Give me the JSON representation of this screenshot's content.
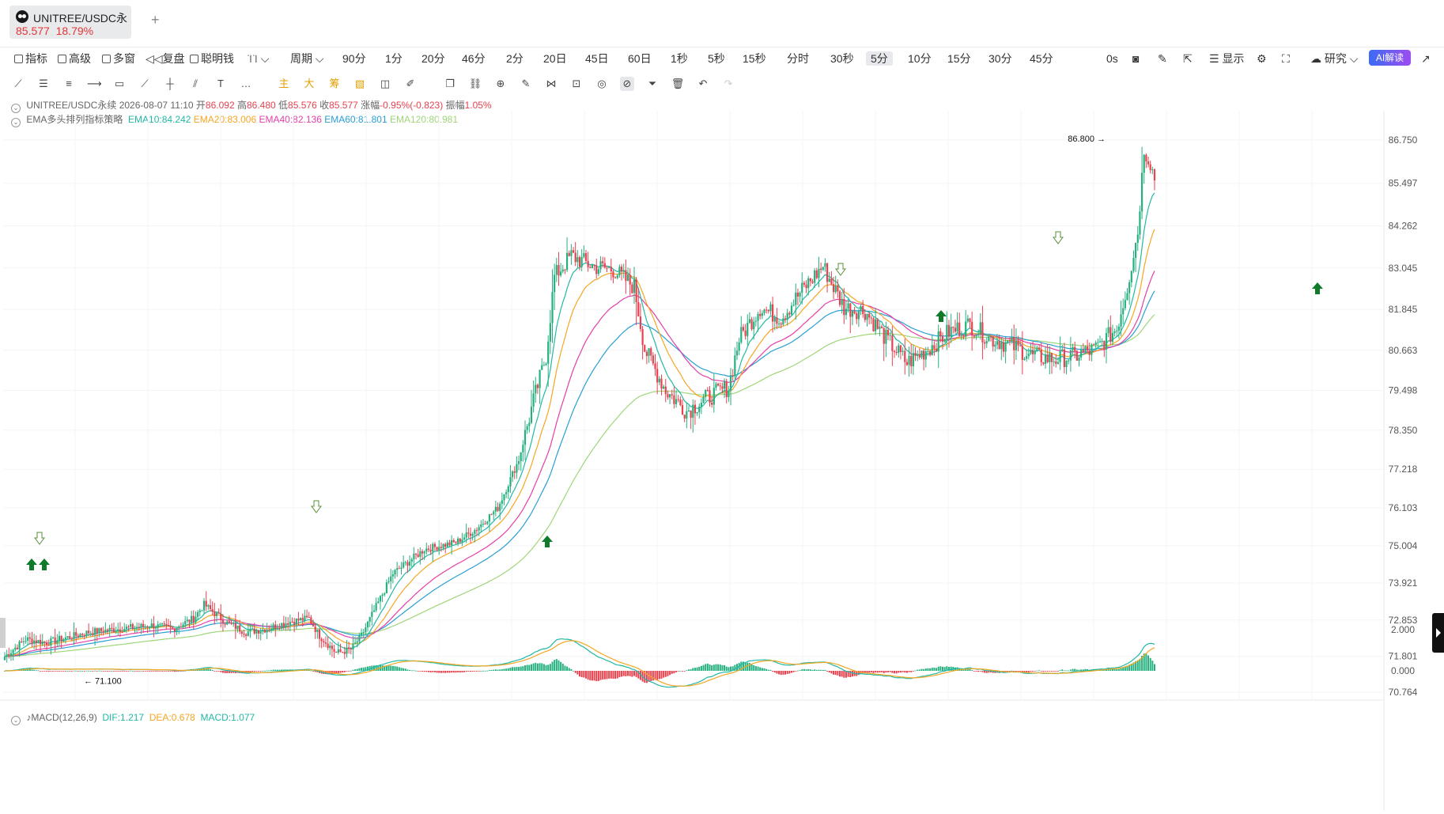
{
  "tab": {
    "title": "UNITREE/USDC永",
    "price": "85.577",
    "change": "18.79%",
    "add_label": "+"
  },
  "toolbar": {
    "indicators": "指标",
    "advanced": "高级",
    "multi_window": "多窗",
    "replay": "复盘",
    "smart_money": "聪明钱",
    "period": "周期",
    "periods": [
      "90分",
      "1分",
      "20分",
      "46分",
      "2分",
      "20日",
      "45日",
      "60日",
      "1秒",
      "5秒",
      "15秒",
      "分时",
      "30秒",
      "5分",
      "10分",
      "15分",
      "30分",
      "45分"
    ],
    "active_period": "5分",
    "seconds": "0s",
    "display": "显示",
    "research": "研究",
    "ai": "AI解读"
  },
  "legend": {
    "symbol": "UNITREE/USDC永续",
    "datetime": "2026-08-07 11:10",
    "open_label": "开",
    "open": "86.092",
    "high_label": "高",
    "high": "86.480",
    "low_label": "低",
    "low": "85.576",
    "close_label": "收",
    "close": "85.577",
    "change_label": "涨幅",
    "change": "-0.95%(-0.823)",
    "amplitude_label": "振幅",
    "amplitude": "1.05%",
    "strategy": "EMA多头排列指标策略",
    "ema10": "EMA10:84.242",
    "ema20": "EMA20:83.006",
    "ema40": "EMA40:82.136",
    "ema60": "EMA60:81.801",
    "ema120": "EMA120:80.981",
    "macd": "MACD(12,26,9)",
    "dif": "DIF:1.217",
    "dea": "DEA:0.678",
    "macd_val": "MACD:1.077"
  },
  "colors": {
    "up": "#26b07f",
    "down": "#e8424f",
    "ema10": "#22b8a5",
    "ema20": "#f5a623",
    "ema40": "#e43fa6",
    "ema60": "#2a9fd6",
    "ema120": "#9fd67a",
    "signal": "#0f7a2a"
  },
  "chart_data": {
    "type": "candlestick",
    "y_ticks": [
      "86.750",
      "85.497",
      "84.262",
      "83.045",
      "81.845",
      "80.663",
      "79.498",
      "78.350",
      "77.218",
      "76.103",
      "75.004",
      "73.921",
      "72.853",
      "71.801",
      "70.764"
    ],
    "y_range": [
      70.764,
      86.75
    ],
    "high_marker": "86.800",
    "low_marker": "71.100",
    "macd_ticks": [
      "2.000",
      "0.000"
    ],
    "close_profile": [
      [
        0,
        71.8
      ],
      [
        10,
        72.3
      ],
      [
        20,
        72.2
      ],
      [
        40,
        72.5
      ],
      [
        55,
        72.6
      ],
      [
        70,
        72.7
      ],
      [
        80,
        72.6
      ],
      [
        90,
        72.9
      ],
      [
        95,
        73.3
      ],
      [
        105,
        72.8
      ],
      [
        115,
        72.5
      ],
      [
        125,
        72.6
      ],
      [
        135,
        72.8
      ],
      [
        145,
        72.9
      ],
      [
        150,
        72.4
      ],
      [
        158,
        71.9
      ],
      [
        165,
        72.0
      ],
      [
        170,
        72.4
      ],
      [
        175,
        73.0
      ],
      [
        185,
        74.2
      ],
      [
        200,
        74.9
      ],
      [
        215,
        75.1
      ],
      [
        225,
        75.5
      ],
      [
        235,
        76.1
      ],
      [
        245,
        77.5
      ],
      [
        252,
        79.2
      ],
      [
        258,
        80.5
      ],
      [
        262,
        82.8
      ],
      [
        270,
        83.4
      ],
      [
        280,
        83.1
      ],
      [
        290,
        83.0
      ],
      [
        300,
        82.5
      ],
      [
        305,
        80.7
      ],
      [
        315,
        79.5
      ],
      [
        325,
        78.9
      ],
      [
        335,
        79.3
      ],
      [
        345,
        79.6
      ],
      [
        350,
        81.0
      ],
      [
        360,
        81.9
      ],
      [
        370,
        81.6
      ],
      [
        380,
        82.4
      ],
      [
        390,
        83.1
      ],
      [
        400,
        81.9
      ],
      [
        410,
        81.8
      ],
      [
        420,
        81.0
      ],
      [
        430,
        80.3
      ],
      [
        440,
        80.7
      ],
      [
        450,
        81.2
      ],
      [
        460,
        81.4
      ],
      [
        470,
        81.0
      ],
      [
        480,
        80.8
      ],
      [
        490,
        80.5
      ],
      [
        500,
        80.4
      ],
      [
        510,
        80.5
      ],
      [
        520,
        80.7
      ],
      [
        530,
        81.3
      ],
      [
        535,
        82.5
      ],
      [
        540,
        84.1
      ],
      [
        543,
        86.5
      ],
      [
        546,
        86.1
      ],
      [
        548,
        85.6
      ]
    ]
  }
}
